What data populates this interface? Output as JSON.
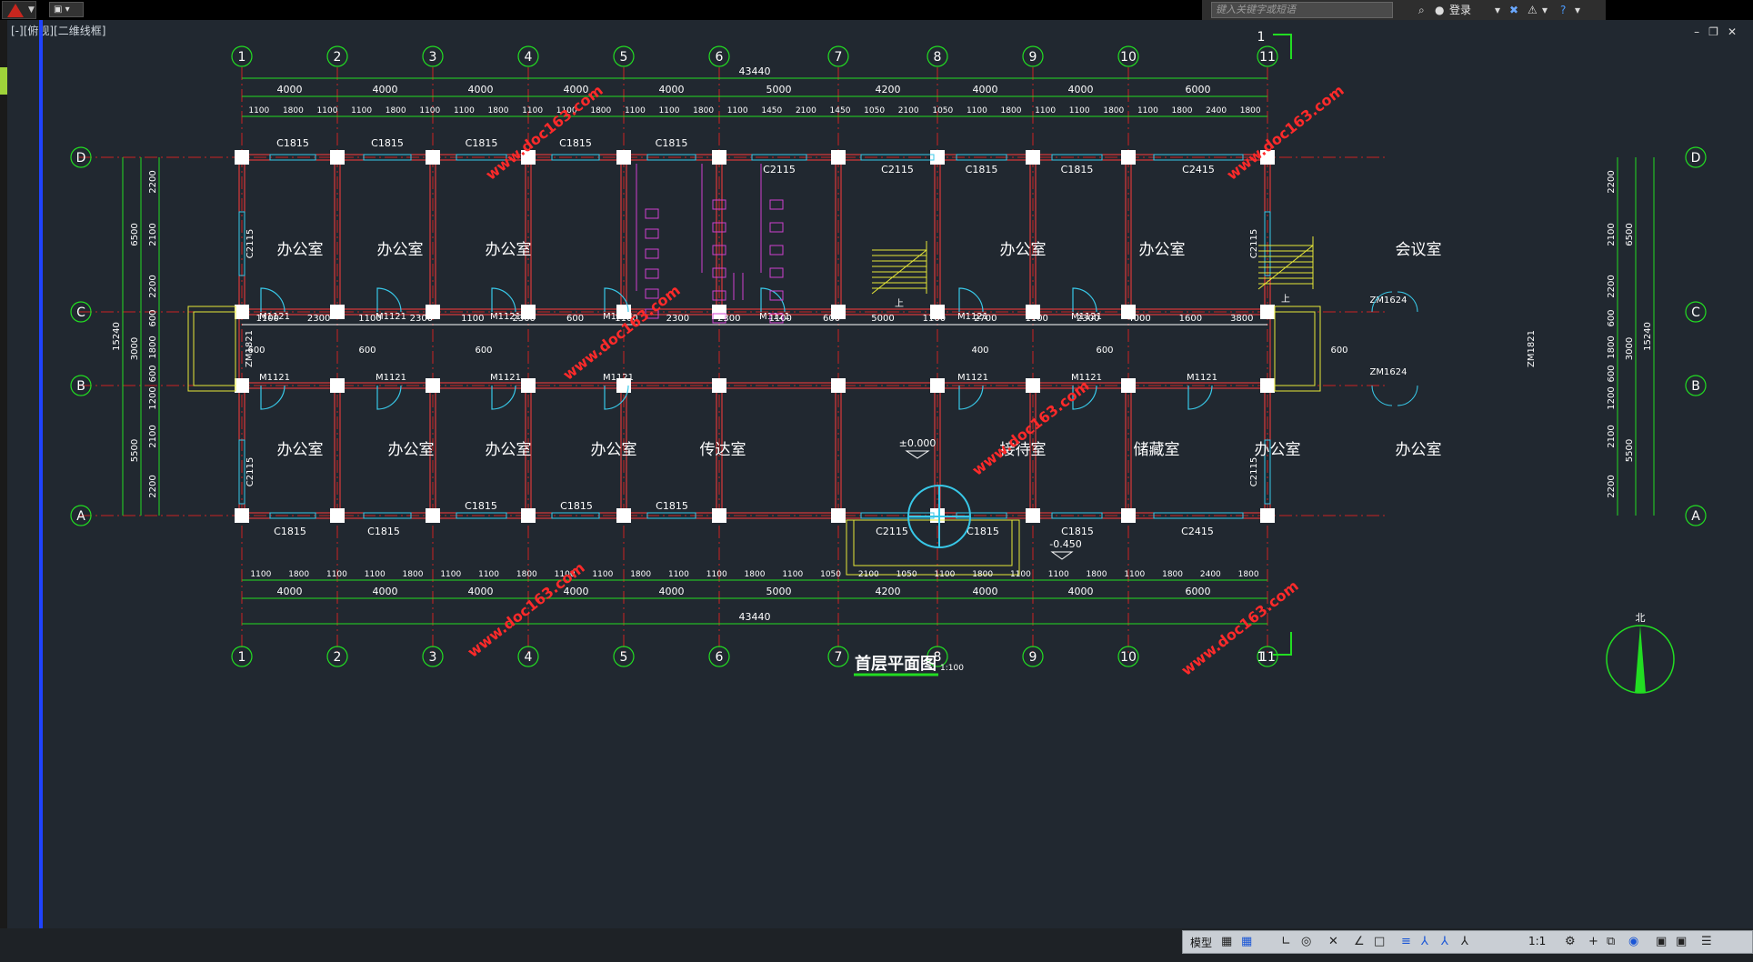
{
  "app": {
    "search_placeholder": "键入关键字或短语",
    "login": "登录",
    "viewport_title": "[-][俯视][二维线框]",
    "status": {
      "model": "模型",
      "scale": "1:1"
    }
  },
  "colors": {
    "bg": "#212830",
    "axis": "#22dd22",
    "wall": "#ff3333",
    "window": "#38c8e8",
    "door": "#38c8e8",
    "text": "#ffffff",
    "stair": "#e8e838",
    "toilet": "#d040d0",
    "watermark": "#ff2a2a"
  },
  "plan": {
    "axes_num": [
      "1",
      "2",
      "3",
      "4",
      "5",
      "6",
      "7",
      "8",
      "9",
      "10",
      "11"
    ],
    "axes_letter": [
      "A",
      "B",
      "C",
      "D"
    ],
    "total_top": "43440",
    "total_bottom": "43440",
    "bays_top": [
      "4000",
      "4000",
      "4000",
      "4000",
      "4000",
      "5000",
      "4200",
      "4000",
      "4000",
      "6000"
    ],
    "bays_bottom": [
      "4000",
      "4000",
      "4000",
      "4000",
      "4000",
      "5000",
      "4200",
      "4000",
      "4000",
      "6000"
    ],
    "open_top": [
      "1100",
      "1800",
      "1100",
      "1100",
      "1800",
      "1100",
      "1100",
      "1800",
      "1100",
      "1100",
      "1800",
      "1100",
      "1100",
      "1800",
      "1100",
      "1450",
      "2100",
      "1450",
      "1050",
      "2100",
      "1050",
      "1100",
      "1800",
      "1100",
      "1100",
      "1800",
      "1100",
      "1800",
      "2400",
      "1800"
    ],
    "open_bottom": [
      "1100",
      "1800",
      "1100",
      "1100",
      "1800",
      "1100",
      "1100",
      "1800",
      "1100",
      "1100",
      "1800",
      "1100",
      "1100",
      "1800",
      "1100",
      "1050",
      "2100",
      "1050",
      "1100",
      "1800",
      "1100",
      "1100",
      "1800",
      "1100",
      "1800",
      "2400",
      "1800"
    ],
    "left_dims": [
      "2200",
      "2100",
      "2200",
      "600",
      "1800",
      "600",
      "1200",
      "2100",
      "2200"
    ],
    "left_dims2": [
      "6500",
      "3000",
      "5500"
    ],
    "left_total": "15240",
    "right_dims": [
      "2200",
      "2100",
      "2200",
      "600",
      "1800",
      "600",
      "1200",
      "2100",
      "2200"
    ],
    "right_dims2": [
      "6500",
      "3000",
      "5500"
    ],
    "right_total": "15240",
    "corridor_dims": [
      "1100",
      "2300",
      "1100",
      "2300",
      "1100",
      "2300",
      "600",
      "1100",
      "2300",
      "2300",
      "1100",
      "600",
      "5000",
      "1100",
      "2700",
      "1100",
      "2300",
      "4000",
      "1600",
      "3800"
    ],
    "corridor_small": [
      "600",
      "600",
      "600",
      "400",
      "600",
      "600"
    ],
    "top_rooms": [
      "办公室",
      "办公室",
      "办公室",
      "办公室",
      "办公室",
      "会议室"
    ],
    "bottom_rooms": [
      "办公室",
      "办公室",
      "办公室",
      "办公室",
      "传达室",
      "接待室",
      "储藏室",
      "办公室",
      "办公室"
    ],
    "top_windows": [
      "C1815",
      "C1815",
      "C1815",
      "C1815",
      "C1815",
      "C2115",
      "C2115",
      "C1815",
      "C1815",
      "C2415"
    ],
    "bottom_windows_in": [
      "C1815",
      "C1815",
      "C1815"
    ],
    "bottom_windows_out": [
      "C1815",
      "C1815",
      "C2115",
      "C1815",
      "C1815",
      "C2415"
    ],
    "side_windows": [
      "C2115",
      "C2115",
      "C2115",
      "C2115"
    ],
    "doors_c": [
      "M1121",
      "M1121",
      "M1121",
      "M1121",
      "M1121",
      "M1121",
      "M1121"
    ],
    "doors_b": [
      "M1121",
      "M1121",
      "M1121",
      "M1121",
      "M1121",
      "M1121",
      "M1121"
    ],
    "zm": [
      "ZM1624",
      "ZM1624",
      "ZM1821",
      "ZM1821"
    ],
    "level_in": "±0.000",
    "level_out": "-0.450",
    "section_mark": "1",
    "up_label": "上",
    "drawing_title": "首层平面图",
    "drawing_scale": "1:100",
    "north": "北",
    "watermark": "www.doc163.com"
  }
}
